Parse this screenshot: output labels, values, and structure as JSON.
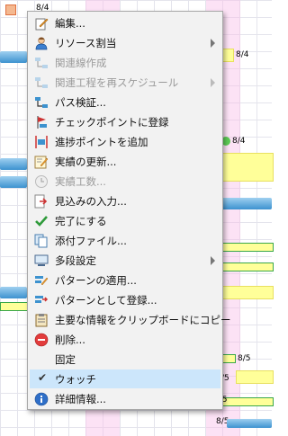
{
  "menu": {
    "items": [
      {
        "label": "編集...",
        "icon": "edit-icon",
        "disabled": false
      },
      {
        "label": "リソース割当",
        "icon": "resource-icon",
        "disabled": false,
        "submenu": true
      },
      {
        "label": "関連線作成",
        "icon": "link-icon",
        "disabled": true
      },
      {
        "label": "関連工程を再スケジュール",
        "icon": "reschedule-icon",
        "disabled": true,
        "submenu": true
      },
      {
        "label": "パス検証...",
        "icon": "path-icon",
        "disabled": false
      },
      {
        "label": "チェックポイントに登録",
        "icon": "checkpoint-icon",
        "disabled": false
      },
      {
        "label": "進捗ポイントを追加",
        "icon": "progress-point-icon",
        "disabled": false
      },
      {
        "label": "実績の更新...",
        "icon": "actual-update-icon",
        "disabled": false
      },
      {
        "label": "実績工数...",
        "icon": "clock-icon",
        "disabled": true
      },
      {
        "label": "見込みの入力...",
        "icon": "forecast-icon",
        "disabled": false
      },
      {
        "label": "完了にする",
        "icon": "check-icon",
        "disabled": false
      },
      {
        "label": "添付ファイル...",
        "icon": "attachment-icon",
        "disabled": false
      },
      {
        "label": "多段設定",
        "icon": "multi-level-icon",
        "disabled": false,
        "submenu": true
      },
      {
        "label": "パターンの適用...",
        "icon": "pattern-apply-icon",
        "disabled": false
      },
      {
        "label": "パターンとして登録...",
        "icon": "pattern-save-icon",
        "disabled": false
      },
      {
        "label": "主要な情報をクリップボードにコピー",
        "icon": "clipboard-icon",
        "disabled": false
      },
      {
        "label": "削除...",
        "icon": "delete-icon",
        "disabled": false
      },
      {
        "label": "固定",
        "icon": "",
        "disabled": false
      },
      {
        "label": "ウォッチ",
        "icon": "checkmark-icon",
        "disabled": false,
        "checked": true,
        "highlighted": true
      },
      {
        "label": "詳細情報...",
        "icon": "info-icon",
        "disabled": false
      }
    ]
  },
  "gantt": {
    "labels": [
      "8/4",
      "8/4",
      "8/4",
      "/5",
      "/5",
      "8/5",
      "8/5",
      "8/5"
    ]
  }
}
